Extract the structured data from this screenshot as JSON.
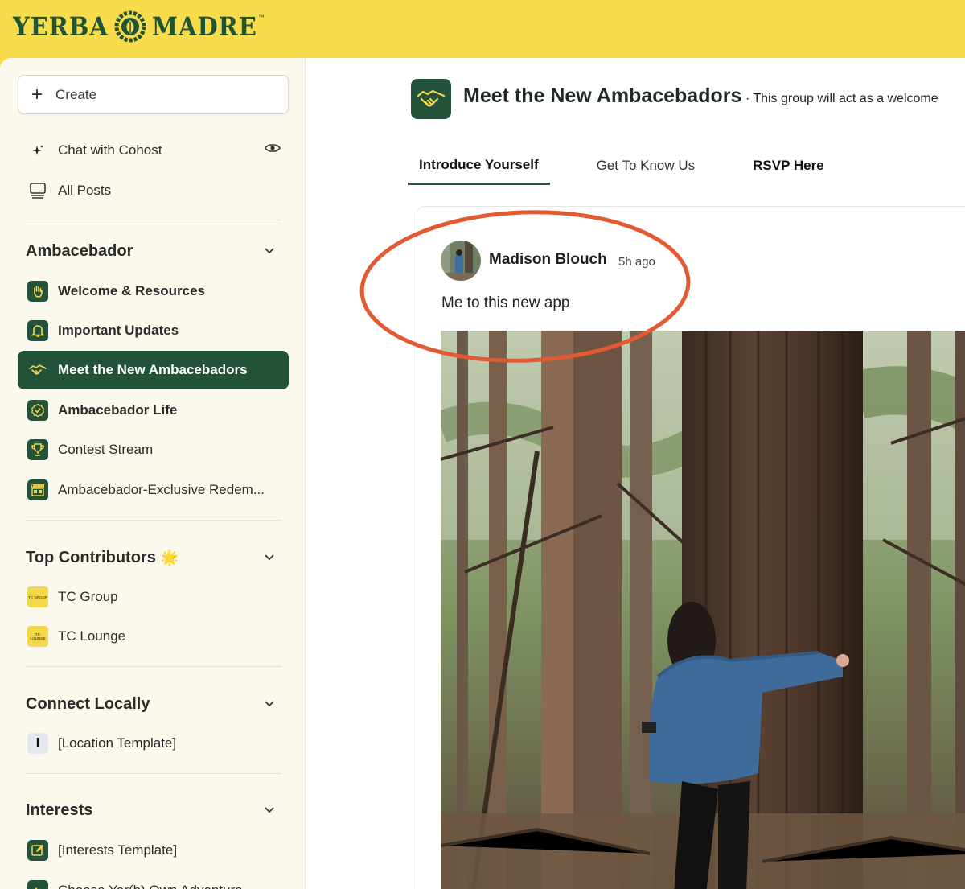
{
  "brand": {
    "left_word": "YERBA",
    "right_word": "MADRE",
    "trademark": "™"
  },
  "sidebar": {
    "create_label": "Create",
    "chat_label": "Chat with Cohost",
    "all_posts_label": "All Posts",
    "sections": [
      {
        "title": "Ambacebador",
        "items": [
          {
            "label": "Welcome & Resources",
            "icon": "waving-hand-icon"
          },
          {
            "label": "Important Updates",
            "icon": "bell-icon"
          },
          {
            "label": "Meet the New Ambacebadors",
            "icon": "handshake-icon",
            "active": true
          },
          {
            "label": "Ambacebador Life",
            "icon": "verified-badge-icon"
          },
          {
            "label": "Contest Stream",
            "icon": "trophy-icon"
          },
          {
            "label": "Ambacebador-Exclusive Redem...",
            "icon": "store-icon"
          }
        ]
      },
      {
        "title": "Top Contributors",
        "emoji": "🌟",
        "items": [
          {
            "label": "TC Group",
            "icon_text": "TC GROUP"
          },
          {
            "label": "TC Lounge",
            "icon_text": "TC LOUNGE"
          }
        ]
      },
      {
        "title": "Connect Locally",
        "items": [
          {
            "label": "[Location Template]",
            "icon_text": "I"
          }
        ]
      },
      {
        "title": "Interests",
        "items": [
          {
            "label": "[Interests Template]",
            "icon": "edit-icon"
          },
          {
            "label": "Choose Yer(b) Own Adventure",
            "icon": "mountain-icon"
          }
        ]
      }
    ]
  },
  "group": {
    "name": "Meet the New Ambacebadors",
    "description": " · This group will act as a welcome",
    "tabs": [
      "Introduce Yourself",
      "Get To Know Us",
      "RSVP Here"
    ],
    "active_tab": "Introduce Yourself"
  },
  "post": {
    "author": "Madison Blouch",
    "time": "5h ago",
    "text": "Me to this new app"
  },
  "colors": {
    "brand_yellow": "#f9dc4c",
    "brand_green": "#23523a",
    "annotation_red": "#e35a32"
  }
}
